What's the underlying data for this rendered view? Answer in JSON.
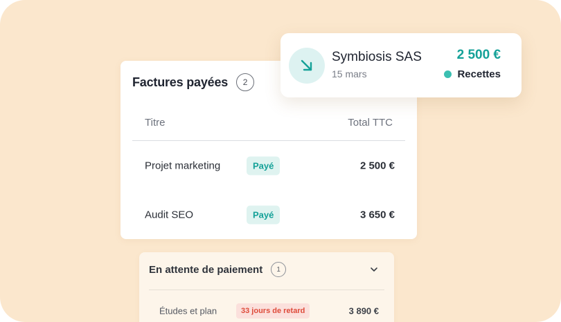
{
  "paid_invoices": {
    "title": "Factures payées",
    "count": "2",
    "columns": {
      "title": "Titre",
      "total": "Total TTC"
    },
    "rows": [
      {
        "title": "Projet marketing",
        "status": "Payé",
        "amount": "2 500 €"
      },
      {
        "title": "Audit SEO",
        "status": "Payé",
        "amount": "3 650 €"
      }
    ]
  },
  "transaction": {
    "icon": "arrow-down-right-icon",
    "name": "Symbiosis SAS",
    "date": "15 mars",
    "amount": "2 500 €",
    "category": "Recettes",
    "amount_color": "#14a198",
    "category_color": "#3bbfb1"
  },
  "pending": {
    "title": "En attente de paiement",
    "count": "1",
    "icon": "chevron-down-icon",
    "rows": [
      {
        "title": "Études et plan",
        "status": "33 jours de retard",
        "amount": "3 890 €"
      }
    ]
  },
  "colors": {
    "background": "#fbe7cd",
    "paid_badge_bg": "#dff3f0",
    "paid_badge_text": "#14a198",
    "late_badge_bg": "#fbe0dc",
    "late_badge_text": "#de4b3a"
  }
}
